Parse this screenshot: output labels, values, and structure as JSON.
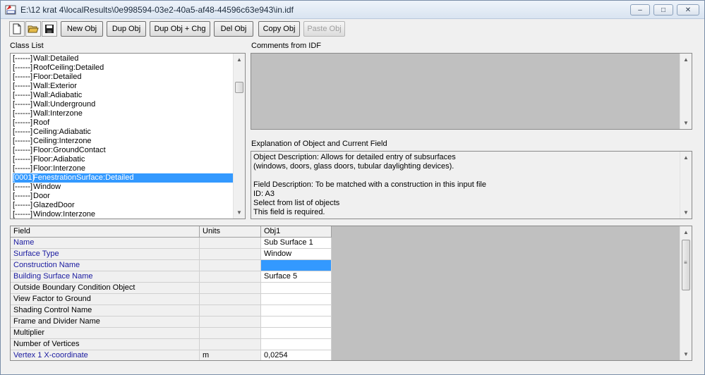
{
  "window": {
    "title": "E:\\12 krat 4\\localResults\\0e998594-03e2-40a5-af48-44596c63e943\\in.idf"
  },
  "toolbar": {
    "icons": [
      "new-file-icon",
      "open-folder-icon",
      "save-icon"
    ],
    "buttons": {
      "new_obj": "New Obj",
      "dup_obj": "Dup Obj",
      "dup_obj_chg": "Dup Obj + Chg",
      "del_obj": "Del Obj",
      "copy_obj": "Copy Obj",
      "paste_obj": "Paste Obj"
    }
  },
  "class_list": {
    "label": "Class List",
    "items": [
      {
        "count": "[------]",
        "name": "Wall:Detailed"
      },
      {
        "count": "[------]",
        "name": "RoofCeiling:Detailed"
      },
      {
        "count": "[------]",
        "name": "Floor:Detailed"
      },
      {
        "count": "[------]",
        "name": "Wall:Exterior"
      },
      {
        "count": "[------]",
        "name": "Wall:Adiabatic"
      },
      {
        "count": "[------]",
        "name": "Wall:Underground"
      },
      {
        "count": "[------]",
        "name": "Wall:Interzone"
      },
      {
        "count": "[------]",
        "name": "Roof"
      },
      {
        "count": "[------]",
        "name": "Ceiling:Adiabatic"
      },
      {
        "count": "[------]",
        "name": "Ceiling:Interzone"
      },
      {
        "count": "[------]",
        "name": "Floor:GroundContact"
      },
      {
        "count": "[------]",
        "name": "Floor:Adiabatic"
      },
      {
        "count": "[------]",
        "name": "Floor:Interzone"
      },
      {
        "count": "[0001]",
        "name": "FenestrationSurface:Detailed",
        "selected": true
      },
      {
        "count": "[------]",
        "name": "Window"
      },
      {
        "count": "[------]",
        "name": "Door"
      },
      {
        "count": "[------]",
        "name": "GlazedDoor"
      },
      {
        "count": "[------]",
        "name": "Window:Interzone"
      }
    ]
  },
  "comments": {
    "label": "Comments from IDF",
    "text": ""
  },
  "explanation": {
    "label": "Explanation of Object and Current Field",
    "lines": [
      "Object Description: Allows for detailed entry of subsurfaces",
      "(windows, doors, glass doors, tubular daylighting devices).",
      "",
      "Field Description:  To be matched with a construction in this input file",
      "ID: A3",
      "Select from list of objects",
      "This field is required."
    ]
  },
  "grid": {
    "headers": {
      "field": "Field",
      "units": "Units",
      "obj": "Obj1"
    },
    "rows": [
      {
        "field": "Name",
        "units": "",
        "value": "Sub Surface 1",
        "required": true
      },
      {
        "field": "Surface Type",
        "units": "",
        "value": "Window",
        "required": true
      },
      {
        "field": "Construction Name",
        "units": "",
        "value": "",
        "required": true,
        "selected": true
      },
      {
        "field": "Building Surface Name",
        "units": "",
        "value": "Surface 5",
        "required": true
      },
      {
        "field": "Outside Boundary Condition Object",
        "units": "",
        "value": "",
        "required": false
      },
      {
        "field": "View Factor to Ground",
        "units": "",
        "value": "",
        "required": false
      },
      {
        "field": "Shading Control Name",
        "units": "",
        "value": "",
        "required": false
      },
      {
        "field": "Frame and Divider Name",
        "units": "",
        "value": "",
        "required": false
      },
      {
        "field": "Multiplier",
        "units": "",
        "value": "",
        "required": false
      },
      {
        "field": "Number of Vertices",
        "units": "",
        "value": "",
        "required": false
      },
      {
        "field": "Vertex 1 X-coordinate",
        "units": "m",
        "value": "0,0254",
        "required": true
      }
    ]
  },
  "colors": {
    "selection": "#3399ff",
    "required_field": "#1a1aa0",
    "panel_gray": "#c0c0c0"
  }
}
